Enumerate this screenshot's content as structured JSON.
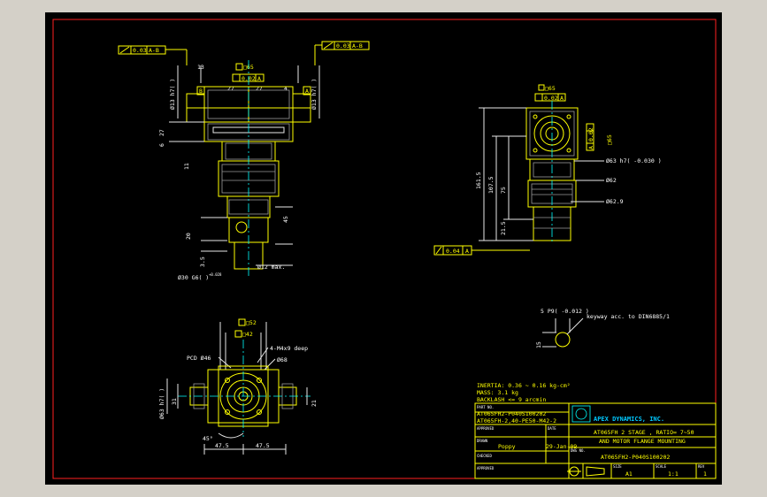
{
  "colors": {
    "background": "#000000",
    "frame": "#ff2020",
    "drawing": "#ffff00",
    "dimensions": "#ffffff",
    "titleblock": "#ffff00",
    "brand": "#00c8ff"
  },
  "side_view": {
    "tol_left": "0.03",
    "tol_left_ref": "A-B",
    "tol_right": "0.03",
    "tol_right_ref": "A-B",
    "sq_65": "□65",
    "flat_002": "0.02",
    "flat_ref": "A",
    "dim_13": "13",
    "dim_27a": "27",
    "dim_27b": "27",
    "dim_4": "4",
    "dia_left": "Ø13 h7(  )",
    "dia_right": "Ø13 h7(  )",
    "tol_small": "-0.018",
    "label_b": "B",
    "label_a": "A",
    "d27": "27",
    "d6": "6",
    "d11": "11",
    "d38": "38",
    "d16_5": "16.5",
    "d3": "3",
    "d46": "46",
    "d45": "45",
    "d3_5": "3.5",
    "d12": "Ø12 max.",
    "d30": "Ø30 G6(  )",
    "tol_30": "+0.028",
    "d20": "20"
  },
  "front_view": {
    "sq_65": "□65",
    "flat_002": "0.02",
    "flat_ref": "A",
    "sq_65v": "□65",
    "d1615": "161.5",
    "d1075": "107.5",
    "d75": "75",
    "d215": "21.5",
    "dia_63": "Ø63 h7( -0.030 )",
    "dia_62": "Ø62",
    "dia_629": "Ø62.9",
    "perp_004": "0.04",
    "perp_ref": "A"
  },
  "key_detail": {
    "key": "5 P9( -0.012 )",
    "keyway": "keyway acc. to DIN6885/1",
    "d15": "15"
  },
  "bottom_view": {
    "sq_52": "□52",
    "sq_42": "□42",
    "holes": "4-M4x9 deep",
    "pcd": "PCD Ø46",
    "d68": "Ø68",
    "dia_63": "Ø63 h7(   )",
    "d31": "31",
    "d21": "21",
    "d45deg": "45°",
    "d475a": "47.5",
    "d475b": "47.5"
  },
  "notes": {
    "inertia": "INERTIA: 0.36 ~ 0.16 kg-cm²",
    "mass": "MASS: 3.1 kg",
    "backlash": "BACKLASH <= 9 arcmin"
  },
  "title_block": {
    "part_no_label": "PART NO.",
    "part_no_1": "AT065FH2-P040S100202",
    "part_no_2": "AT065FH-2,40-PE50-M42-2",
    "company": "APEX DYNAMICS, INC.",
    "approved_label": "APPROVED",
    "date_label": "DATE",
    "drawn_label": "DRAWN",
    "drawn_by": "Poppy",
    "date": "29-Jan-09",
    "checked_label": "CHECKED",
    "approved2_label": "APPROVED",
    "title_line1": "AT065FH 2 STAGE , RATIO= 7~50",
    "title_line2": "AND MOTOR FLANGE MOUNTING",
    "dwg_label": "DWG NO.",
    "dwg_no": "AT065FH2-P040S100202",
    "size_label": "SIZE",
    "scale_label": "SCALE",
    "rev_label": "REV",
    "size": "A1",
    "scale": "1:1",
    "rev": "1"
  }
}
